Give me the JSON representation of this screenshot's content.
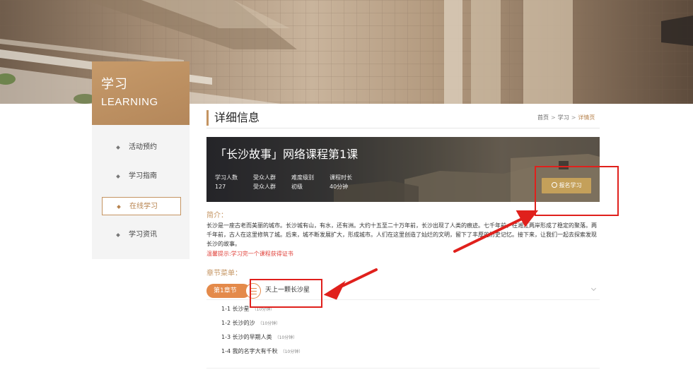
{
  "section": {
    "title_cn": "学习",
    "title_en": "LEARNING"
  },
  "sidebar": {
    "items": [
      {
        "label": "活动预约",
        "active": false
      },
      {
        "label": "学习指南",
        "active": false
      },
      {
        "label": "在线学习",
        "active": true
      },
      {
        "label": "学习资讯",
        "active": false
      }
    ]
  },
  "main": {
    "title": "详细信息",
    "breadcrumb": [
      "首页",
      "学习",
      "详情页"
    ],
    "course": {
      "title": "「长沙故事」网络课程第1课",
      "stats": [
        {
          "label": "学习人数",
          "value": "127"
        },
        {
          "label": "受众人群",
          "value": "受众人群"
        },
        {
          "label": "难度级别",
          "value": "初级"
        },
        {
          "label": "课程时长",
          "value": "40分钟"
        }
      ],
      "enroll_label": "报名学习"
    },
    "intro_label": "简介：",
    "intro_text": "长沙是一座古老而美丽的城市。长沙城有山，有水，还有洲。大约十五至二十万年前，长沙出现了人类的痕迹。七千年前，在湘江两岸形成了稳定的聚落。两千年前，古人在这里修筑了城。后来，城不断发展扩大，形成城市。人们在这里创造了灿烂的文明，留下了丰厚的历史记忆。接下来，让我们一起去探索发现长沙的故事。",
    "tip": "温馨提示:学习完一个课程获得证书",
    "chapters_label": "章节菜单：",
    "chapter": {
      "badge": "第1章节",
      "title": "天上一颗长沙星",
      "lessons": [
        {
          "title": "1-1 长沙星",
          "duration": "（10分钟）"
        },
        {
          "title": "1-2 长沙的沙",
          "duration": "（10分钟）"
        },
        {
          "title": "1-3 长沙的早期人类",
          "duration": "（10分钟）"
        },
        {
          "title": "1-4 我的名字大有千秋",
          "duration": "（10分钟）"
        }
      ]
    }
  },
  "colors": {
    "accent": "#c49461",
    "orange": "#e48a4a",
    "annotation_red": "#e0201c",
    "tip_red": "#e0413a",
    "gold_button": "#c4a05a"
  }
}
